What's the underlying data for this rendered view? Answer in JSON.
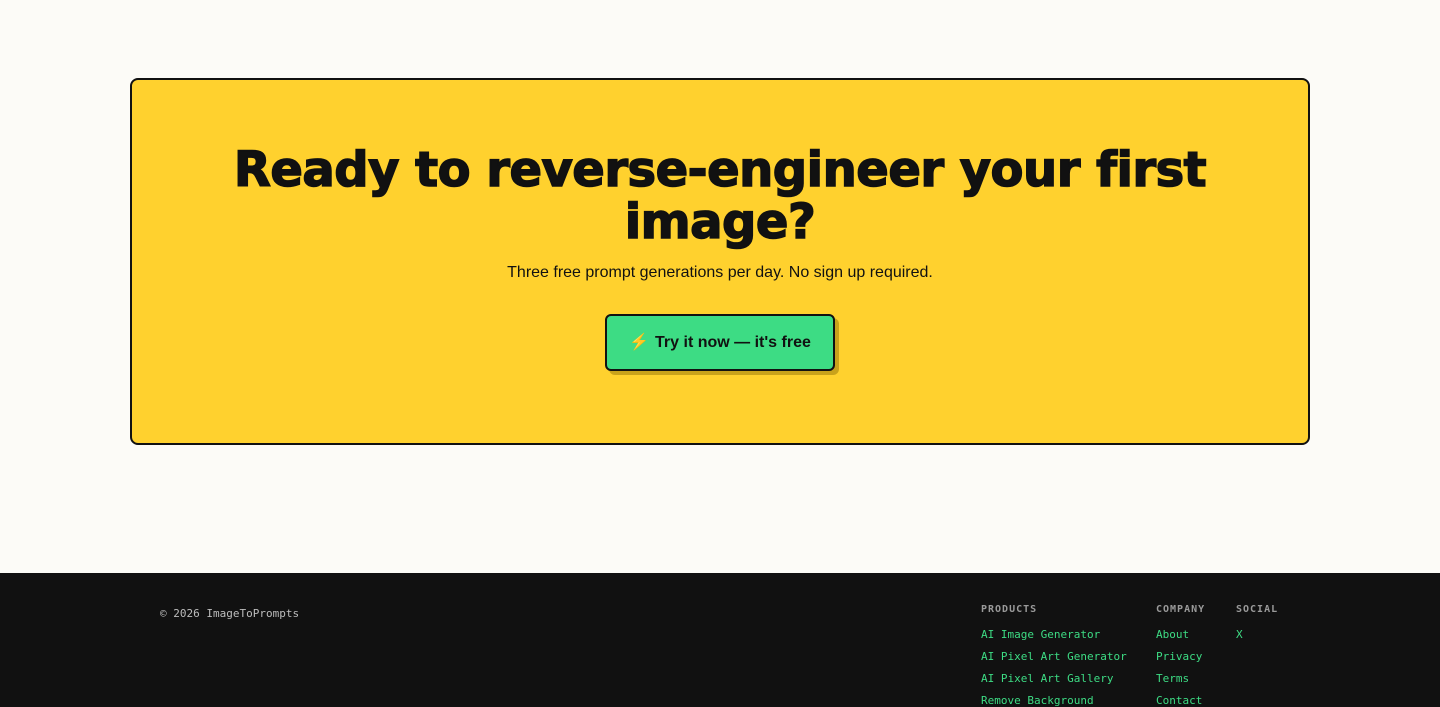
{
  "cta": {
    "title": "Ready to reverse-engineer your first image?",
    "subtitle": "Three free prompt generations per day. No sign up required.",
    "button_icon": "⚡",
    "button_label": "Try it now — it's free"
  },
  "footer": {
    "copyright": "© 2026 ImageToPrompts",
    "products": {
      "heading": "PRODUCTS",
      "links": [
        "AI Image Generator",
        "AI Pixel Art Generator",
        "AI Pixel Art Gallery",
        "Remove Background"
      ]
    },
    "company": {
      "heading": "COMPANY",
      "links": [
        "About",
        "Privacy",
        "Terms",
        "Contact"
      ]
    },
    "social": {
      "heading": "SOCIAL",
      "links": [
        "X"
      ]
    }
  },
  "colors": {
    "page_background": "#fcfbf7",
    "cta_background": "#ffd12e",
    "button_background": "#3ddc84",
    "footer_background": "#111111",
    "footer_link": "#3ddc84"
  }
}
